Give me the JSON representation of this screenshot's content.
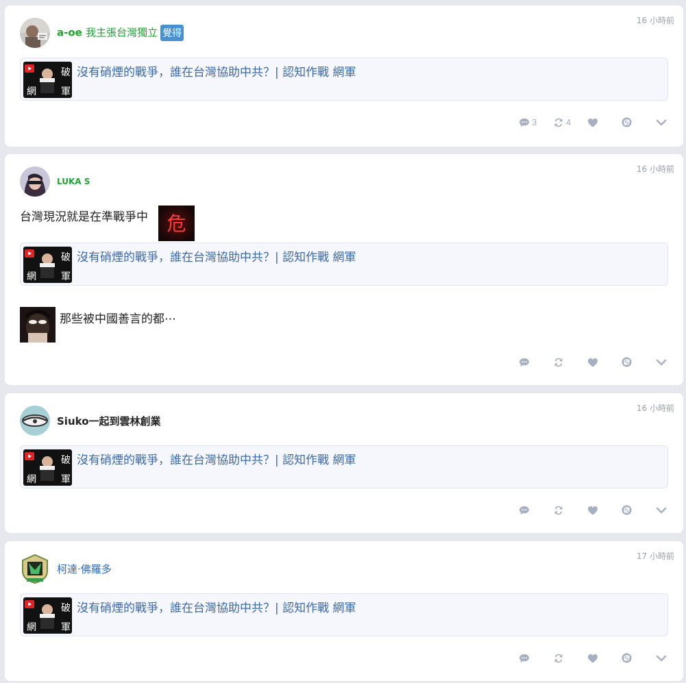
{
  "posts": [
    {
      "author": "a-oe",
      "author_extra": "我主張台灣獨立",
      "badge": "覺得",
      "time": "16 小時前",
      "link_title": "沒有硝煙的戰爭，誰在台灣協助中共？| 認知作戰 網軍",
      "actions": {
        "reply_count": "3",
        "repost_count": "4"
      }
    },
    {
      "author": "LUKA S",
      "time": "16 小時前",
      "text": "台灣現況就是在準戰爭中",
      "sticker_char": "危",
      "link_title": "沒有硝煙的戰爭，誰在台灣協助中共？| 認知作戰 網軍",
      "extra_text": "那些被中國善言的都⋯",
      "actions": {}
    },
    {
      "author": "Siuko一起到雲林創業",
      "time": "16 小時前",
      "link_title": "沒有硝煙的戰爭，誰在台灣協助中共？| 認知作戰 網軍",
      "actions": {}
    },
    {
      "author": "柯達·佛羅多",
      "time": "17 小時前",
      "link_title": "沒有硝煙的戰爭，誰在台灣協助中共？| 認知作戰 網軍",
      "actions": {}
    }
  ],
  "thumb_text": {
    "top": "破",
    "bottom_left": "網",
    "bottom_right": "軍"
  },
  "colors": {
    "author_green": "#22a334",
    "author_blue": "#2f6ab8",
    "author_dark": "#222222",
    "link_blue": "#3d6aa8",
    "icon_gray": "#a7b0c0",
    "time_gray": "#9aa1ae",
    "badge_blue": "#4a8fd0"
  },
  "icons": [
    "comment-icon",
    "repost-icon",
    "heart-icon",
    "block-icon",
    "chevron-down-icon"
  ]
}
